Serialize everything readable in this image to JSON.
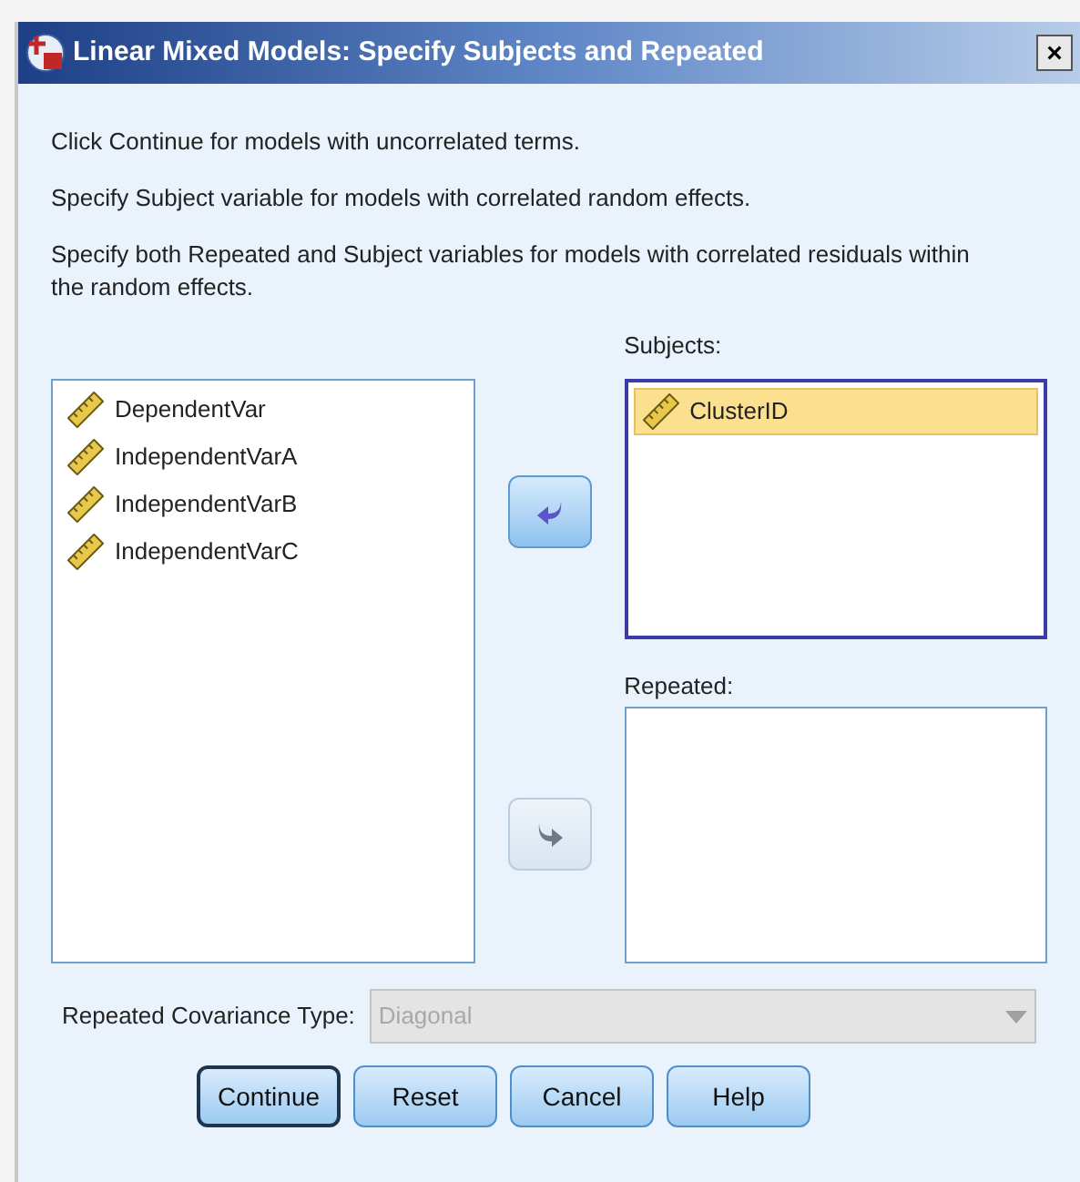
{
  "window": {
    "title": "Linear Mixed Models: Specify Subjects and Repeated",
    "close": "×"
  },
  "instructions": [
    "Click Continue for models with uncorrelated terms.",
    "Specify Subject variable for models with correlated random effects.",
    "Specify both Repeated and Subject variables for models with correlated residuals within the random effects."
  ],
  "variables": [
    {
      "name": "DependentVar",
      "selected": false
    },
    {
      "name": "IndependentVarA",
      "selected": false
    },
    {
      "name": "IndependentVarB",
      "selected": false
    },
    {
      "name": "IndependentVarC",
      "selected": false
    }
  ],
  "subjects": {
    "label": "Subjects:",
    "move_disabled": false,
    "items": [
      {
        "name": "ClusterID",
        "selected": true
      }
    ]
  },
  "repeated": {
    "label": "Repeated:",
    "move_disabled": true
  },
  "covariance": {
    "label": "Repeated Covariance Type:",
    "value": "Diagonal",
    "disabled": true
  },
  "buttons": [
    {
      "label": "Continue",
      "default": true
    },
    {
      "label": "Reset",
      "default": false
    },
    {
      "label": "Cancel",
      "default": false
    },
    {
      "label": "Help",
      "default": false
    }
  ]
}
